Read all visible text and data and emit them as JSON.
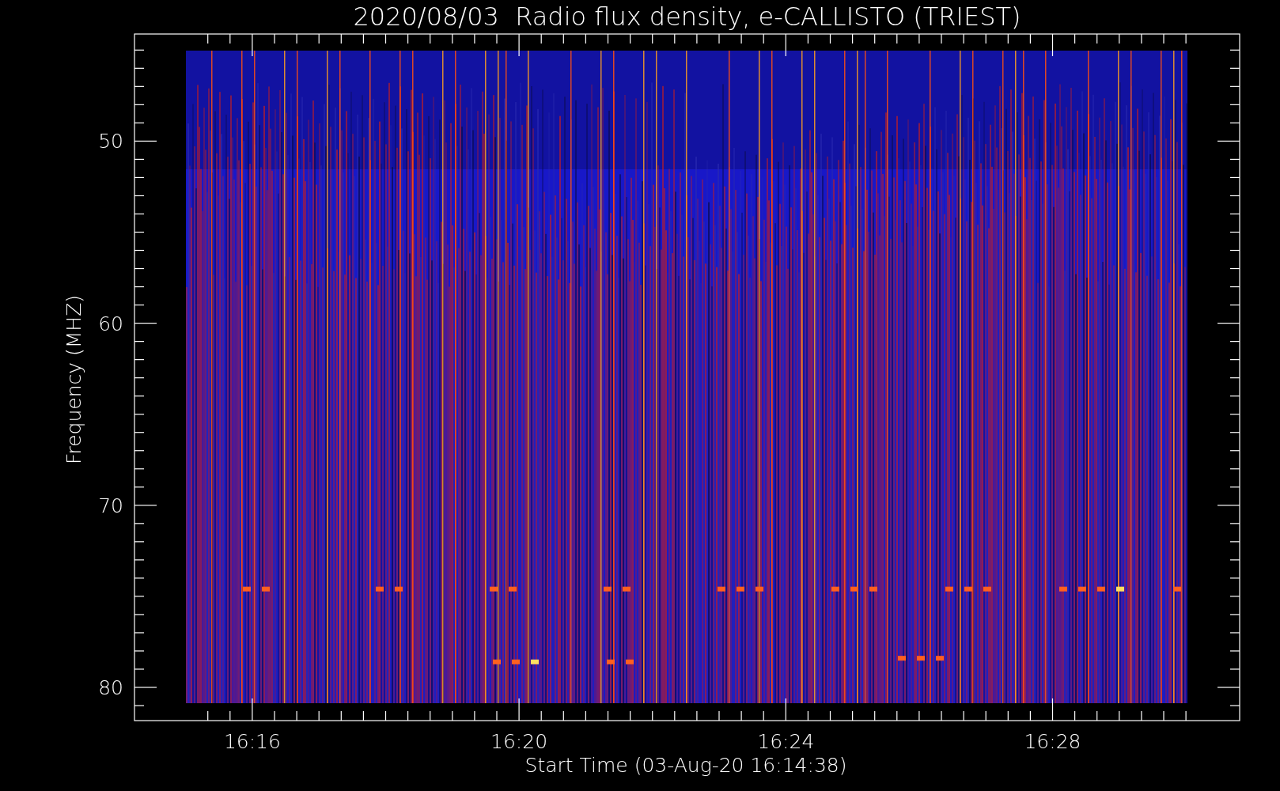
{
  "chart": {
    "title": "2020/08/03  Radio flux density, e-CALLISTO (TRIEST)",
    "ylabel": "Frequency (MHZ)",
    "xlabel": "Start Time (03-Aug-20 16:14:38)",
    "yticks": [
      "50",
      "60",
      "70",
      "80"
    ],
    "xticks": [
      "16:16",
      "16:20",
      "16:24",
      "16:28"
    ]
  }
}
